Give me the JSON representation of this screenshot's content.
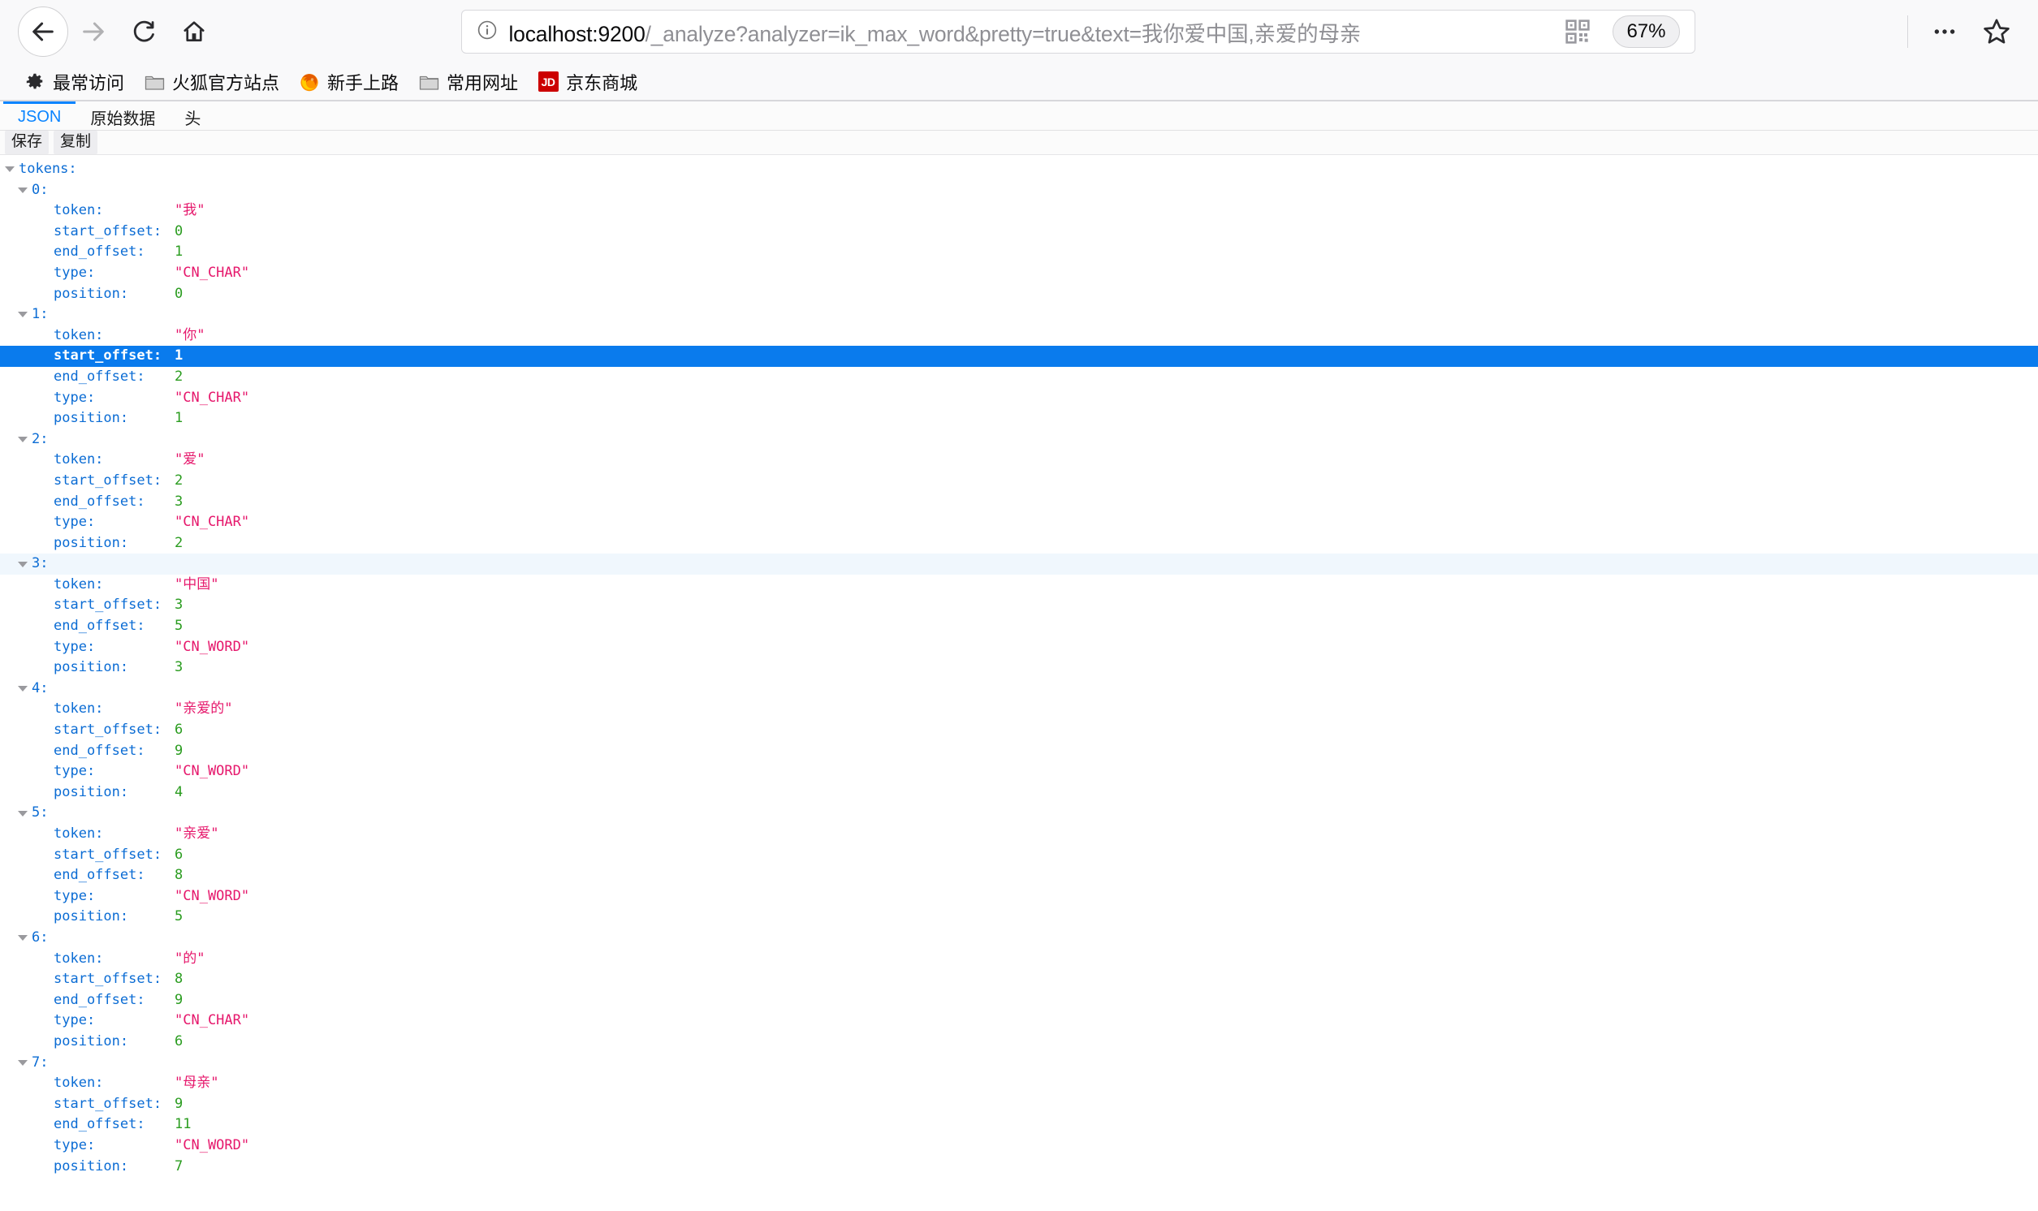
{
  "browser": {
    "nav": {
      "back_label": "Back",
      "forward_label": "Forward",
      "reload_label": "Reload",
      "home_label": "Home"
    },
    "urlbar": {
      "identity_icon": "info-circle-icon",
      "host": "localhost:9200",
      "path": "/_analyze?analyzer=ik_max_word&pretty=true&text=",
      "query_text": "我你爱中国,亲爱的母亲",
      "full_url": "localhost:9200/_analyze?analyzer=ik_max_word&pretty=true&text=我你爱中国,亲爱的母亲",
      "qr_icon": "qr-code-icon",
      "zoom_level": "67%",
      "menu_icon": "ellipsis-icon",
      "bookmark_icon": "star-icon"
    },
    "bookmarks": [
      {
        "label": "最常访问",
        "icon": "gear-icon"
      },
      {
        "label": "火狐官方站点",
        "icon": "folder-icon"
      },
      {
        "label": "新手上路",
        "icon": "firefox-icon"
      },
      {
        "label": "常用网址",
        "icon": "folder-icon"
      },
      {
        "label": "京东商城",
        "icon": "jd-icon",
        "icon_text": "JD"
      }
    ]
  },
  "json_viewer": {
    "tabs": [
      {
        "label": "JSON",
        "active": true
      },
      {
        "label": "原始数据",
        "active": false
      },
      {
        "label": "头",
        "active": false
      }
    ],
    "toolbar": [
      {
        "label": "保存"
      },
      {
        "label": "复制"
      }
    ],
    "root_key": "tokens",
    "keys": {
      "token": "token",
      "start_offset": "start_offset",
      "end_offset": "end_offset",
      "type": "type",
      "position": "position"
    },
    "selected_row": {
      "index": 1,
      "field": "start_offset"
    },
    "tokens": [
      {
        "idx": "0",
        "token": "\"我\"",
        "start_offset": "0",
        "end_offset": "1",
        "type": "\"CN_CHAR\"",
        "position": "0"
      },
      {
        "idx": "1",
        "token": "\"你\"",
        "start_offset": "1",
        "end_offset": "2",
        "type": "\"CN_CHAR\"",
        "position": "1"
      },
      {
        "idx": "2",
        "token": "\"爱\"",
        "start_offset": "2",
        "end_offset": "3",
        "type": "\"CN_CHAR\"",
        "position": "2"
      },
      {
        "idx": "3",
        "token": "\"中国\"",
        "start_offset": "3",
        "end_offset": "5",
        "type": "\"CN_WORD\"",
        "position": "3"
      },
      {
        "idx": "4",
        "token": "\"亲爱的\"",
        "start_offset": "6",
        "end_offset": "9",
        "type": "\"CN_WORD\"",
        "position": "4"
      },
      {
        "idx": "5",
        "token": "\"亲爱\"",
        "start_offset": "6",
        "end_offset": "8",
        "type": "\"CN_WORD\"",
        "position": "5"
      },
      {
        "idx": "6",
        "token": "\"的\"",
        "start_offset": "8",
        "end_offset": "9",
        "type": "\"CN_CHAR\"",
        "position": "6"
      },
      {
        "idx": "7",
        "token": "\"母亲\"",
        "start_offset": "9",
        "end_offset": "11",
        "type": "\"CN_WORD\"",
        "position": "7"
      }
    ]
  },
  "colors": {
    "selection_blue": "#0a7bed",
    "key_blue": "#0b6cd4",
    "string_pink": "#e6186c",
    "number_green": "#2a9c1f",
    "tab_active_blue": "#0a84ff",
    "alt_row": "#f0f7fd",
    "jd_red": "#cc0000"
  }
}
